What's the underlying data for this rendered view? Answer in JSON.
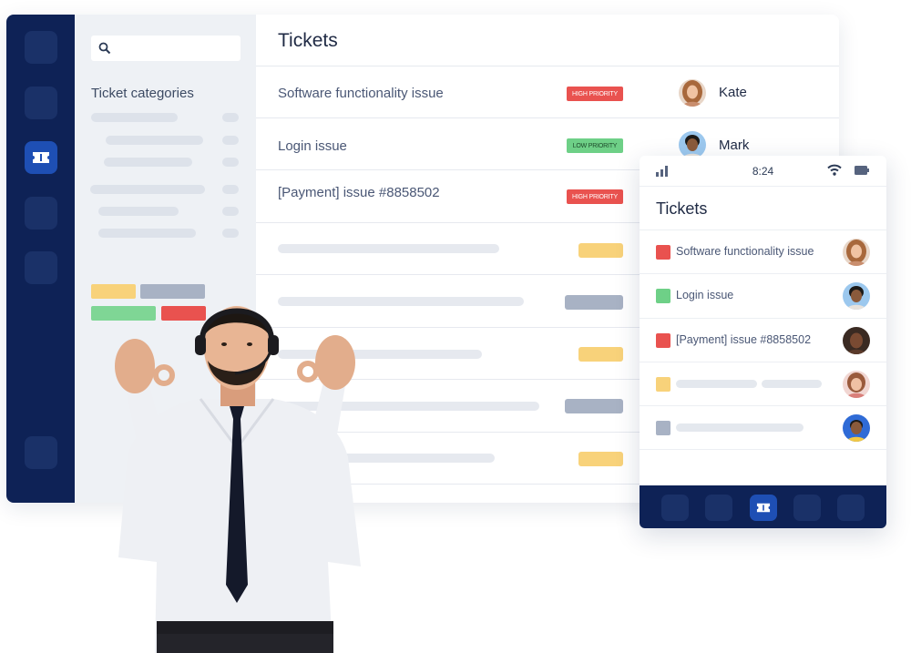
{
  "sidebar": {
    "title": "Ticket categories",
    "search_placeholder": ""
  },
  "main": {
    "title": "Tickets",
    "rows": [
      {
        "label": "Software functionality issue",
        "priority": "HIGH PRIORITY",
        "assignee": "Kate"
      },
      {
        "label": "Login issue",
        "priority": "LOW PRIORITY",
        "assignee": "Mark"
      },
      {
        "label": "[Payment] issue #8858502",
        "priority": "HIGH PRIORITY",
        "assignee": ""
      }
    ]
  },
  "mobile": {
    "time": "8:24",
    "title": "Tickets",
    "rows": [
      {
        "label": "Software functionality issue",
        "color": "#e9524f"
      },
      {
        "label": "Login issue",
        "color": "#6ed087"
      },
      {
        "label": "[Payment] issue #8858502",
        "color": "#e9524f"
      }
    ]
  },
  "colors": {
    "navy": "#0e2256",
    "accent": "#1e4fb4",
    "high": "#e9524f",
    "low": "#6ed087",
    "yellow": "#f8d27a",
    "gray_tag": "#a8b2c4"
  }
}
